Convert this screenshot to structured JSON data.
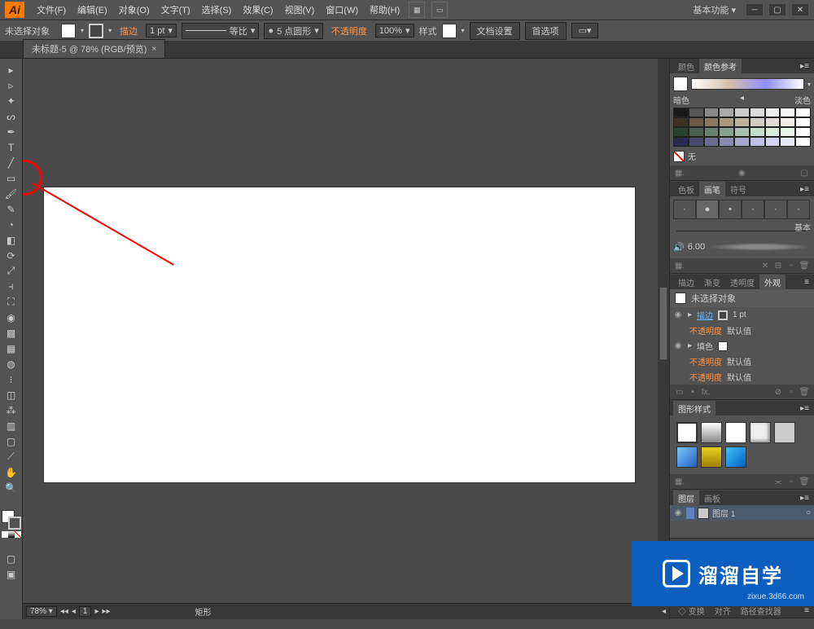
{
  "app": {
    "logo": "Ai",
    "workspace": "基本功能"
  },
  "menu": {
    "file": "文件(F)",
    "edit": "编辑(E)",
    "object": "对象(O)",
    "type": "文字(T)",
    "select": "选择(S)",
    "effect": "效果(C)",
    "view": "视图(V)",
    "window": "窗口(W)",
    "help": "帮助(H)"
  },
  "control": {
    "noselect": "未选择对象",
    "stroke": "描边",
    "stroke_pt": "1 pt",
    "profile": "等比",
    "brush_pt": "5 点圆形",
    "opacity": "不透明度",
    "opacity_val": "100%",
    "style": "样式",
    "docsetup": "文档设置",
    "prefs": "首选项"
  },
  "tab": {
    "title": "未标题-5 @ 78% (RGB/预览)"
  },
  "status": {
    "zoom": "78%",
    "artboard_nav": "1",
    "tool": "矩形"
  },
  "panels": {
    "color": {
      "tab1": "颜色",
      "tab2": "颜色参考",
      "dark": "暗色",
      "light": "淡色",
      "none": "无"
    },
    "swatches": {
      "tab1": "色板",
      "tab2": "画笔",
      "tab3": "符号",
      "basic": "基本",
      "size": "6.00"
    },
    "appearance": {
      "tab1": "描边",
      "tab2": "渐变",
      "tab3": "透明度",
      "tab4": "外观",
      "title": "未选择对象",
      "stroke": "描边",
      "stroke_val": "1 pt",
      "opacity": "不透明度",
      "fill": "填色",
      "default": "默认值"
    },
    "graphicstyles": {
      "tab1": "图形样式"
    },
    "layers": {
      "tab1": "图层",
      "tab2": "画板",
      "layer1": "图层 1"
    },
    "transform": {
      "tab1": "变换",
      "tab2": "对齐",
      "tab3": "路径查找器"
    }
  },
  "watermark": {
    "text": "溜溜自学",
    "url": "zixue.3d66.com"
  }
}
